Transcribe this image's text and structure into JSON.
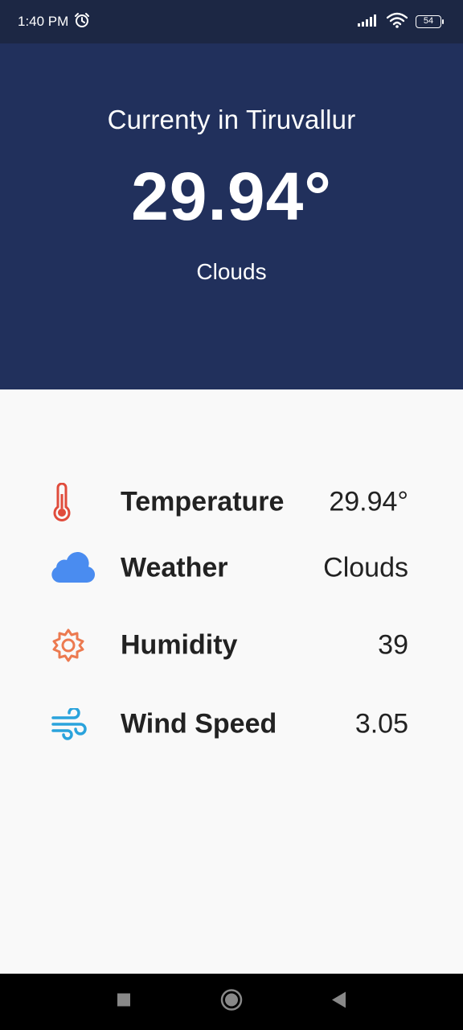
{
  "status_bar": {
    "time": "1:40 PM",
    "battery": "54"
  },
  "header": {
    "location_text": "Currenty in Tiruvallur",
    "temperature": "29.94°",
    "condition": "Clouds",
    "background_color": "#21305c"
  },
  "details": [
    {
      "icon": "thermometer-icon",
      "label": "Temperature",
      "value": "29.94°",
      "icon_color": "#e04c3c"
    },
    {
      "icon": "cloud-icon",
      "label": "Weather",
      "value": "Clouds",
      "icon_color": "#4a8cf0"
    },
    {
      "icon": "sun-gear-icon",
      "label": "Humidity",
      "value": "39",
      "icon_color": "#ec7a50"
    },
    {
      "icon": "wind-icon",
      "label": "Wind Speed",
      "value": "3.05",
      "icon_color": "#2aa3dc"
    }
  ],
  "nav_bar": {
    "recents_icon": "square-icon",
    "home_icon": "circle-icon",
    "back_icon": "triangle-back-icon"
  }
}
